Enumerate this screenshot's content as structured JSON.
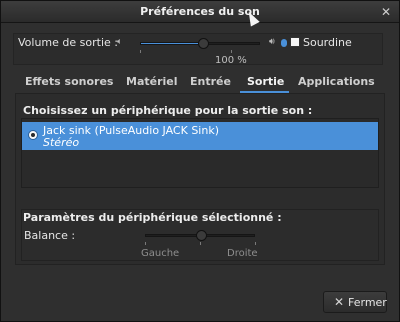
{
  "window": {
    "title": "Préférences du son"
  },
  "volume": {
    "label": "Volume de sortie :",
    "percent_text": "100 %",
    "level": 0.52,
    "mute_label": "Sourdine",
    "mute_checked": false
  },
  "tabs": [
    {
      "label": "Effets sonores"
    },
    {
      "label": "Matériel"
    },
    {
      "label": "Entrée"
    },
    {
      "label": "Sortie",
      "active": true
    },
    {
      "label": "Applications"
    }
  ],
  "output": {
    "choose_title": "Choisissez un périphérique pour la sortie son :",
    "devices": [
      {
        "name": "Jack sink (PulseAudio JACK Sink)",
        "profile": "Stéréo",
        "selected": true
      }
    ],
    "params_title": "Paramètres du périphérique sélectionné :",
    "balance": {
      "label": "Balance :",
      "left_label": "Gauche",
      "right_label": "Droite",
      "value": 0.5
    }
  },
  "footer": {
    "close_label": "Fermer"
  },
  "colors": {
    "accent": "#4a90d9",
    "background": "#2f2f2f"
  },
  "icons": {
    "window_close": "close-icon",
    "speaker": "speaker-icon",
    "close_button": "close-icon"
  }
}
